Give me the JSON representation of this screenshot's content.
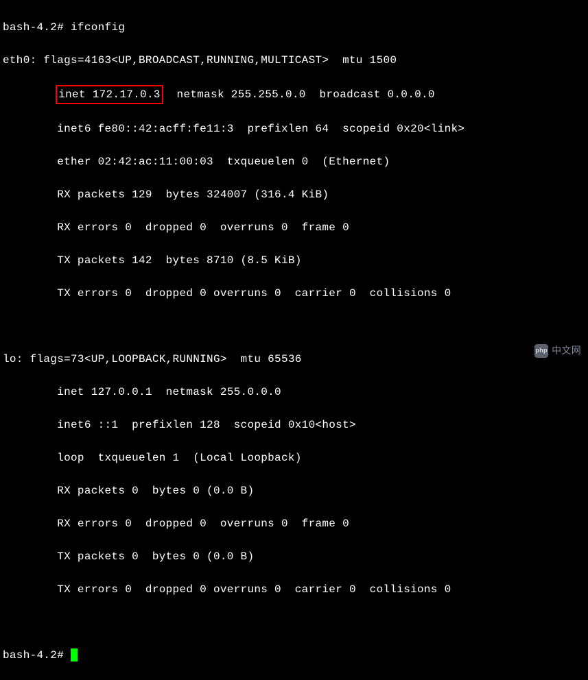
{
  "terminal": {
    "prompt": "bash-4.2#",
    "command": "ifconfig",
    "eth0": {
      "header": "eth0: flags=4163<UP,BROADCAST,RUNNING,MULTICAST>  mtu 1500",
      "inet_highlighted": "inet 172.17.0.3",
      "inet_rest": "  netmask 255.255.0.0  broadcast 0.0.0.0",
      "inet6": "        inet6 fe80::42:acff:fe11:3  prefixlen 64  scopeid 0x20<link>",
      "ether": "        ether 02:42:ac:11:00:03  txqueuelen 0  (Ethernet)",
      "rx_packets": "        RX packets 129  bytes 324007 (316.4 KiB)",
      "rx_errors": "        RX errors 0  dropped 0  overruns 0  frame 0",
      "tx_packets": "        TX packets 142  bytes 8710 (8.5 KiB)",
      "tx_errors": "        TX errors 0  dropped 0 overruns 0  carrier 0  collisions 0"
    },
    "lo": {
      "header": "lo: flags=73<UP,LOOPBACK,RUNNING>  mtu 65536",
      "inet": "        inet 127.0.0.1  netmask 255.0.0.0",
      "inet6": "        inet6 ::1  prefixlen 128  scopeid 0x10<host>",
      "loop": "        loop  txqueuelen 1  (Local Loopback)",
      "rx_packets": "        RX packets 0  bytes 0 (0.0 B)",
      "rx_errors": "        RX errors 0  dropped 0  overruns 0  frame 0",
      "tx_packets": "        TX packets 0  bytes 0 (0.0 B)",
      "tx_errors": "        TX errors 0  dropped 0 overruns 0  carrier 0  collisions 0"
    },
    "final_prompt": "bash-4.2# "
  },
  "watermark": {
    "icon_text": "php",
    "label": "中文网"
  }
}
